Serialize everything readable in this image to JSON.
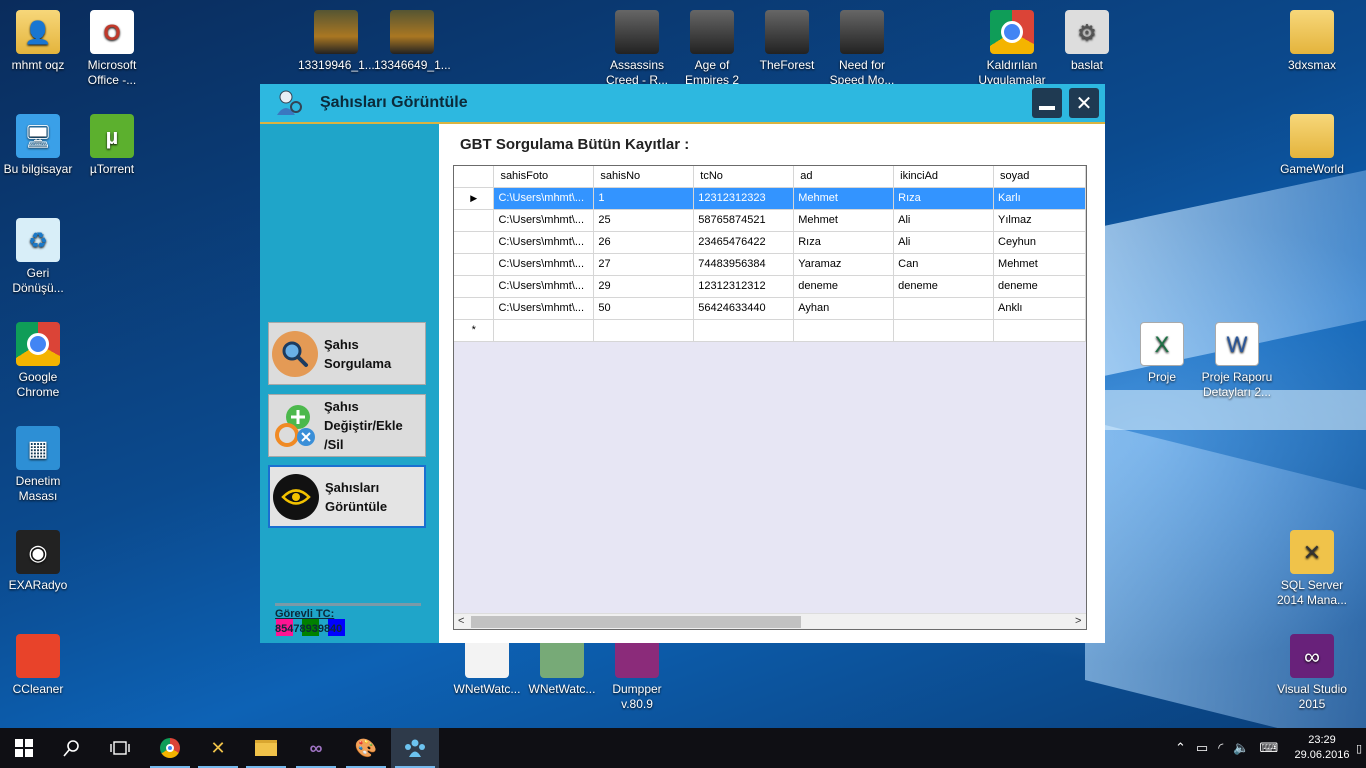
{
  "desktop_icons": [
    {
      "label": "mhmt oqz",
      "icon": "user-folder-icon"
    },
    {
      "label": "Microsoft Office -...",
      "icon": "office-icon"
    },
    {
      "label": "13319946_1...",
      "icon": "image-icon"
    },
    {
      "label": "13346649_1...",
      "icon": "image-icon"
    },
    {
      "label": "Assassins Creed - R...",
      "icon": "game-icon"
    },
    {
      "label": "Age of Empires 2",
      "icon": "game-icon"
    },
    {
      "label": "TheForest",
      "icon": "game-icon"
    },
    {
      "label": "Need for Speed Mo...",
      "icon": "game-icon"
    },
    {
      "label": "Kaldırılan Uygulamalar",
      "icon": "chrome-icon"
    },
    {
      "label": "baslat",
      "icon": "settings-icon"
    },
    {
      "label": "3dxsmax",
      "icon": "folder-icon"
    },
    {
      "label": "Bu bilgisayar",
      "icon": "computer-icon"
    },
    {
      "label": "µTorrent",
      "icon": "torrent-icon"
    },
    {
      "label": "GameWorld",
      "icon": "folder-icon"
    },
    {
      "label": "Geri Dönüşü...",
      "icon": "recycle-bin-icon"
    },
    {
      "label": "Google Chrome",
      "icon": "chrome-icon"
    },
    {
      "label": "Proje",
      "icon": "excel-icon"
    },
    {
      "label": "Proje Raporu Detayları 2...",
      "icon": "word-icon"
    },
    {
      "label": "Denetim Masası",
      "icon": "control-panel-icon"
    },
    {
      "label": "EXARadyo",
      "icon": "radio-icon"
    },
    {
      "label": "SQL Server 2014 Mana...",
      "icon": "sql-server-icon"
    },
    {
      "label": "CCleaner",
      "icon": "ccleaner-icon"
    },
    {
      "label": "WNetWatc...",
      "icon": "blank-file-icon"
    },
    {
      "label": "WNetWatc...",
      "icon": "network-icon"
    },
    {
      "label": "Dumpper v.80.9",
      "icon": "rar-icon"
    },
    {
      "label": "Visual Studio 2015",
      "icon": "visual-studio-icon"
    }
  ],
  "window": {
    "title": "Şahısları Görüntüle",
    "sidebar": {
      "buttons": [
        {
          "label": "Şahıs\nSorgulama",
          "icon": "search-icon"
        },
        {
          "label": "Şahıs\nDeğiştir/Ekle\n/Sil",
          "icon": "add-edit-icon"
        },
        {
          "label": "Şahısları\nGörüntüle",
          "icon": "eye-icon"
        }
      ],
      "swatches": [
        "#ff1493",
        "#008000",
        "#0000ff"
      ],
      "gorevli_label": "Görevli TC:",
      "gorevli_value": "85478939840"
    },
    "main": {
      "heading": "GBT Sorgulama Bütün Kayıtlar :",
      "columns": [
        "sahisFoto",
        "sahisNo",
        "tcNo",
        "ad",
        "ikinciAd",
        "soyad"
      ],
      "rows": [
        [
          "C:\\Users\\mhmt\\...",
          "1",
          "12312312323",
          "Mehmet",
          "Rıza",
          "Karlı"
        ],
        [
          "C:\\Users\\mhmt\\...",
          "25",
          "58765874521",
          "Mehmet",
          "Ali",
          "Yılmaz"
        ],
        [
          "C:\\Users\\mhmt\\...",
          "26",
          "23465476422",
          "Rıza",
          "Ali",
          "Ceyhun"
        ],
        [
          "C:\\Users\\mhmt\\...",
          "27",
          "74483956384",
          "Yaramaz",
          "Can",
          "Mehmet"
        ],
        [
          "C:\\Users\\mhmt\\...",
          "29",
          "12312312312",
          "deneme",
          "deneme",
          "deneme"
        ],
        [
          "C:\\Users\\mhmt\\...",
          "50",
          "56424633440",
          "Ayhan",
          "",
          "Anklı"
        ]
      ],
      "selected_row_marker": "▶",
      "new_row_marker": "*"
    }
  },
  "taskbar": {
    "time": "23:29",
    "date": "29.06.2016"
  },
  "colors": {
    "window_bg": "#1fa5c9",
    "titlebar": "#2db8e0",
    "selection": "#3394ff"
  }
}
